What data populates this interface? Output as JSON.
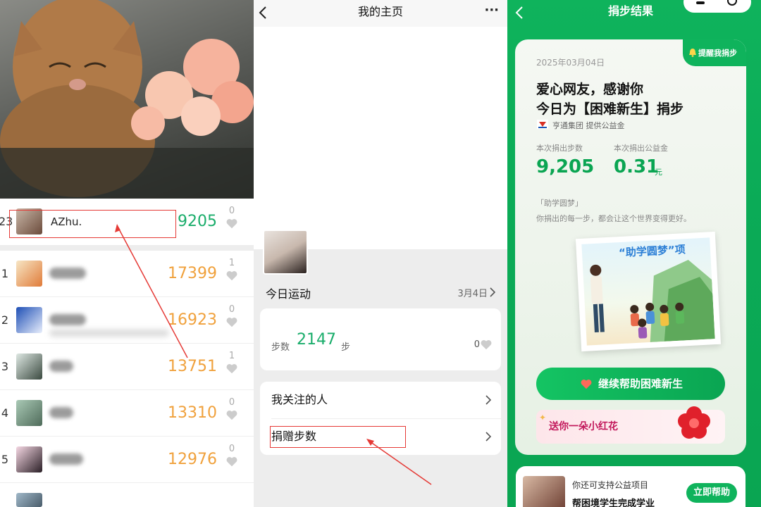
{
  "leaderboard": {
    "me": {
      "rank": "23",
      "name": "AZhu.",
      "steps": "9205",
      "likes": "0"
    },
    "rows": [
      {
        "rank": "1",
        "steps": "17399",
        "likes": "1"
      },
      {
        "rank": "2",
        "steps": "16923",
        "likes": "0"
      },
      {
        "rank": "3",
        "steps": "13751",
        "likes": "1"
      },
      {
        "rank": "4",
        "steps": "13310",
        "likes": "0"
      },
      {
        "rank": "5",
        "steps": "12976",
        "likes": "0"
      }
    ]
  },
  "profile": {
    "title": "我的主页",
    "back_icon": "chevron-left-icon",
    "more_label": "···",
    "today_label": "今日运动",
    "today_date": "3月4日",
    "steps_prefix": "步数",
    "steps_value": "2147",
    "steps_unit": "步",
    "likes": "0",
    "menu": [
      {
        "label": "我关注的人"
      },
      {
        "label": "捐赠步数"
      }
    ]
  },
  "result": {
    "title": "捐步结果",
    "remind_label": "提醒我捐步",
    "date": "2025年03月04日",
    "thanks_line1": "爱心网友，感谢你",
    "thanks_line2": "今日为【困难新生】捐步",
    "sponsor": "亨通集团 提供公益金",
    "steps_label": "本次捐出步数",
    "steps_value": "9,205",
    "fund_label": "本次捐出公益金",
    "fund_value": "0.31",
    "fund_unit": "元",
    "project_tag": "「助学圆梦」",
    "project_desc": "你捐出的每一步，都会让这个世界变得更好。",
    "poster_title": "“助学圆梦”项",
    "continue_label": "继续帮助困难新生",
    "flower_label": "送你一朵小红花",
    "support_label": "你还可支持公益项目",
    "support_project": "帮困境学生完成学业",
    "help_label": "立即帮助"
  },
  "colors": {
    "green": "#07c160",
    "orange": "#f0a13c",
    "red_box": "#e53935"
  }
}
